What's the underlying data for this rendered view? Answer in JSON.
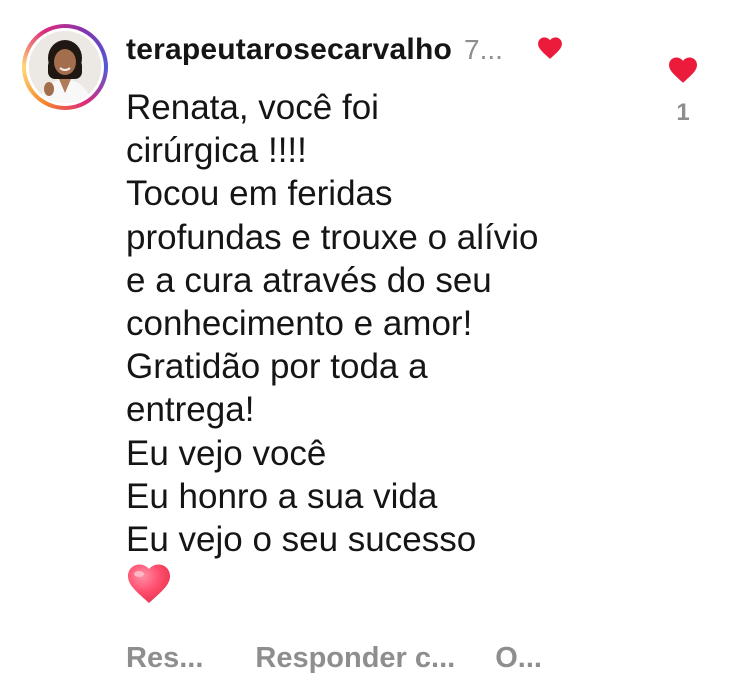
{
  "comment": {
    "username": "terapeutarosecarvalho",
    "timestamp": "7...",
    "lines": [
      "Renata, você foi",
      "cirúrgica !!!!",
      "Tocou em feridas",
      "profundas e trouxe o alívio",
      "e a cura através do seu",
      "conhecimento e amor!",
      "Gratidão por toda a",
      "entrega!",
      "Eu vejo você",
      "Eu honro a sua vida",
      "Eu vejo o seu sucesso"
    ],
    "emoji": "heart-emoji"
  },
  "like": {
    "count": "1",
    "icon": "heart-icon",
    "color": "#ed1b3b"
  },
  "actions": {
    "reply": "Res...",
    "reply_private": "Responder c...",
    "other": "O..."
  },
  "icons": {
    "avatar": "avatar",
    "moon": "moon-icon",
    "creator_heart": "heart-icon"
  },
  "colors": {
    "text": "#151515",
    "muted": "#8e8e8e",
    "heart": "#ed1b3b"
  }
}
